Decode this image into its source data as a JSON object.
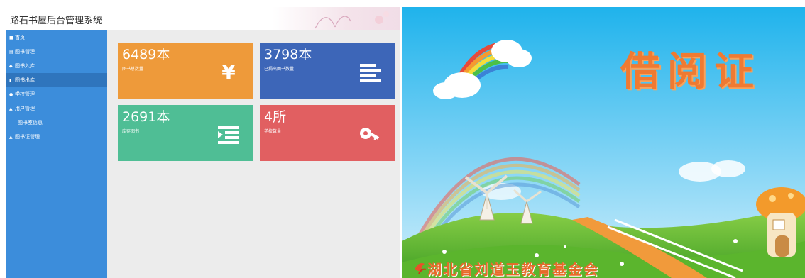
{
  "admin": {
    "app_title": "路石书屋后台管理系统",
    "sidebar": {
      "items": [
        {
          "icon": "home-icon",
          "label": "首页"
        },
        {
          "icon": "book-icon",
          "label": "图书管理"
        },
        {
          "icon": "import-icon",
          "label": "图书入库"
        },
        {
          "icon": "file-icon",
          "label": "图书出库"
        },
        {
          "icon": "school-icon",
          "label": "学校管理"
        },
        {
          "icon": "user-icon",
          "label": "用户管理"
        },
        {
          "icon": "",
          "label": "图书室信息"
        },
        {
          "icon": "user-icon",
          "label": "图书证管理"
        }
      ]
    },
    "cards": [
      {
        "value": "6489本",
        "label": "图书总数量",
        "color": "#ee9a3a",
        "icon": "yen-icon"
      },
      {
        "value": "3798本",
        "label": "已捐出图书数量",
        "color": "#3d66b8",
        "icon": "align-left-icon"
      },
      {
        "value": "2691本",
        "label": "库存图书",
        "color": "#4fbe95",
        "icon": "indent-icon"
      },
      {
        "value": "4所",
        "label": "学校数量",
        "color": "#e15f61",
        "icon": "key-icon"
      }
    ]
  },
  "library_card": {
    "title": "借阅证",
    "org": "湖北省刘道玉教育基金会"
  }
}
